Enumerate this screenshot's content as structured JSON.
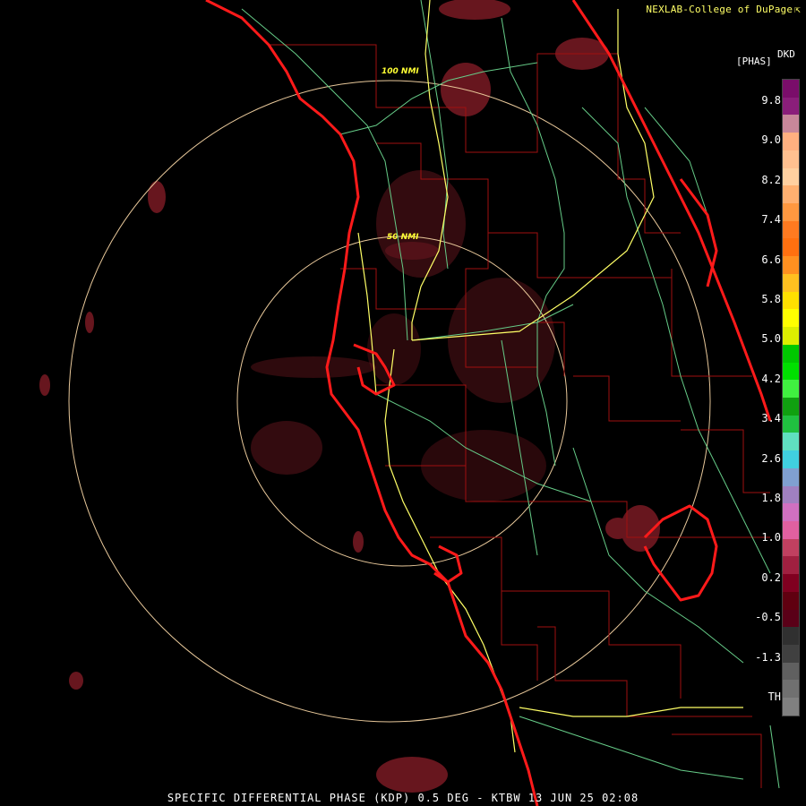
{
  "credit": "NEXLAB-College of DuPage",
  "credit_icon": "cursor-arrow-icon",
  "title": "SPECIFIC DIFFERENTIAL PHASE (KDP) 0.5 DEG - KTBW 13 JUN 25 02:08",
  "legend": {
    "product": "DKD",
    "units": "[PHAS]",
    "ticks": [
      "9.8",
      "9.0",
      "8.2",
      "7.4",
      "6.6",
      "5.8",
      "5.0",
      "4.2",
      "3.4",
      "2.6",
      "1.8",
      "1.0",
      "0.2",
      "-0.5",
      "-1.3",
      "TH"
    ],
    "colors": [
      "#7a0d6a",
      "#8a1e7a",
      "#c8879a",
      "#ffb080",
      "#ffc090",
      "#ffd0a0",
      "#ffb070",
      "#ff9840",
      "#ff7a20",
      "#ff7010",
      "#ff9020",
      "#ffc020",
      "#ffe000",
      "#ffff00",
      "#ddee00",
      "#00c800",
      "#00e000",
      "#40f040",
      "#10a010",
      "#20c040",
      "#60e0c0",
      "#40d0e0",
      "#80a0d0",
      "#a080c0",
      "#d070c0",
      "#e060a0",
      "#c04060",
      "#a02040",
      "#800020",
      "#600010",
      "#5a0018",
      "#303030",
      "#404040",
      "#606060",
      "#707070",
      "#808080"
    ]
  },
  "range_rings": [
    {
      "label": "100 NMI"
    },
    {
      "label": "50 NMI"
    }
  ],
  "colors": {
    "coastline": "#ff1a1a",
    "county": "#a01010",
    "highway": "#ffff66",
    "road": "#66cc88",
    "ring": "#e8c89a",
    "echo": "#7a1a24"
  }
}
